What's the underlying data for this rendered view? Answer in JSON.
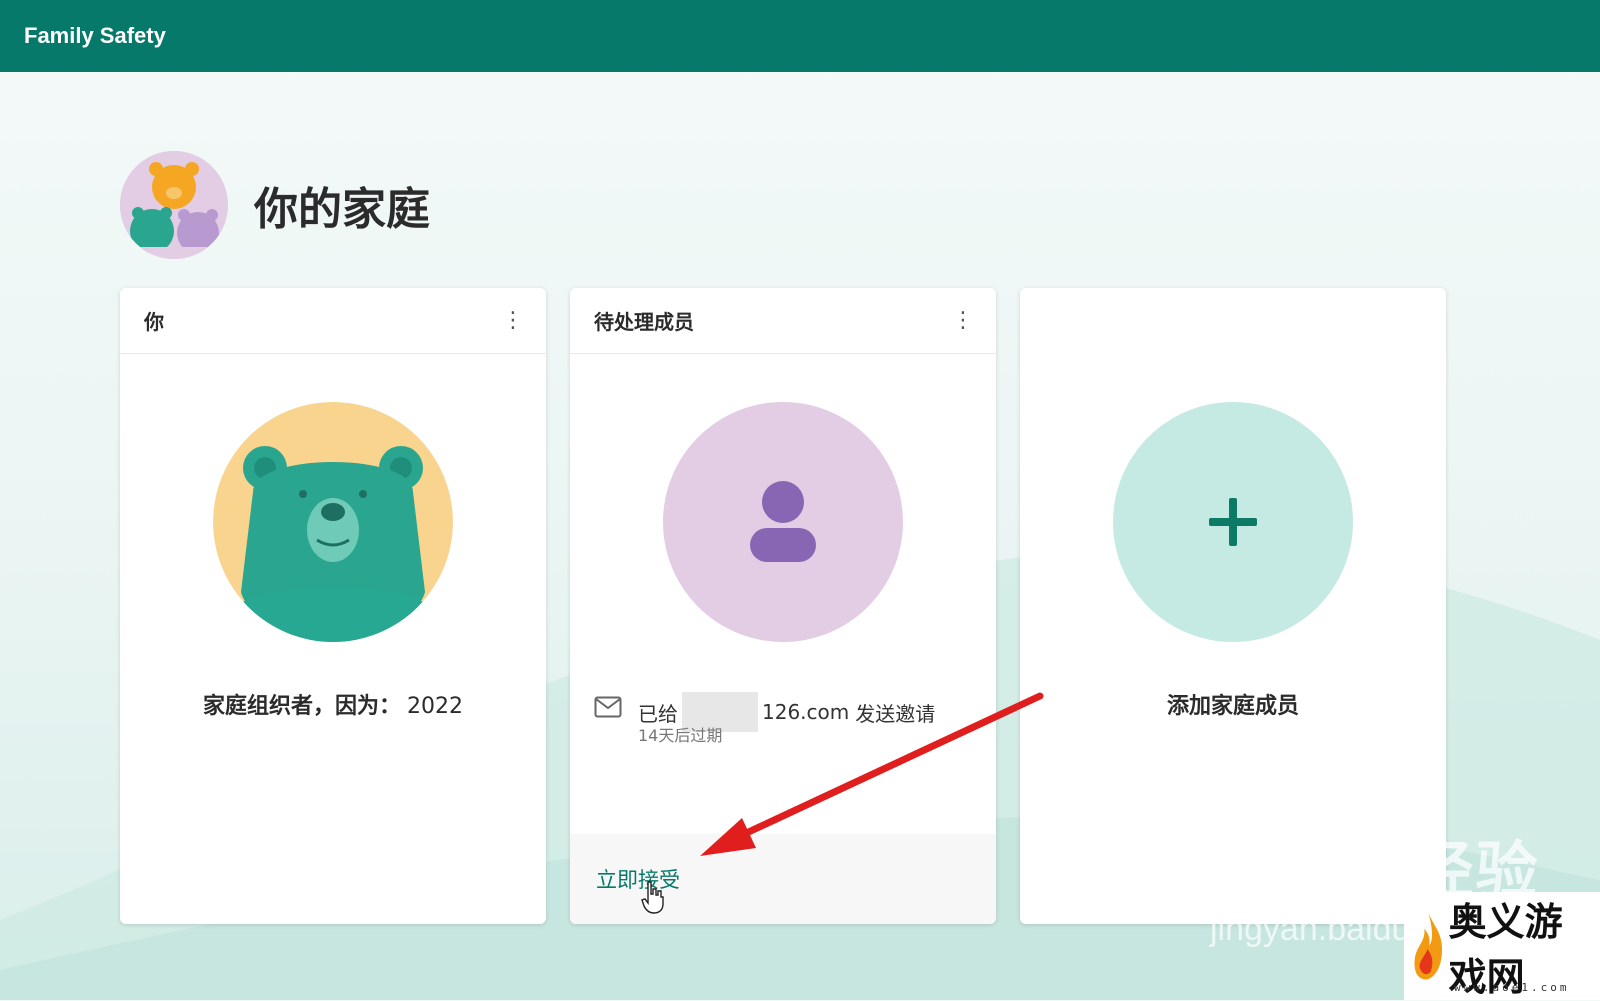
{
  "app": {
    "title": "Family Safety"
  },
  "page": {
    "title": "你的家庭"
  },
  "cards": {
    "you": {
      "title": "你",
      "role_label": "家庭组织者，因为：",
      "year": "2022"
    },
    "pending": {
      "title": "待处理成员",
      "invite_prefix": "已给",
      "invite_email_visible": "126.com",
      "invite_suffix": "发送邀请",
      "expiry": "14天后过期",
      "accept_label": "立即接受"
    },
    "add": {
      "label": "添加家庭成员"
    }
  },
  "icons": {
    "menu": "more-vertical-icon",
    "mail": "mail-icon",
    "person": "person-icon",
    "plus": "plus-icon"
  },
  "colors": {
    "topbar": "#07796a",
    "accent": "#07796a",
    "pending_avatar": "#e2cde4",
    "add_circle": "#c5eae3",
    "bear_bg": "#f9d48f",
    "arrow": "#e01e1e"
  },
  "watermark": {
    "main": "Baidu 经验",
    "sub": "jingyan.baidu",
    "logo_text": "奥义游戏网",
    "logo_url": "www.aoe1.com"
  }
}
